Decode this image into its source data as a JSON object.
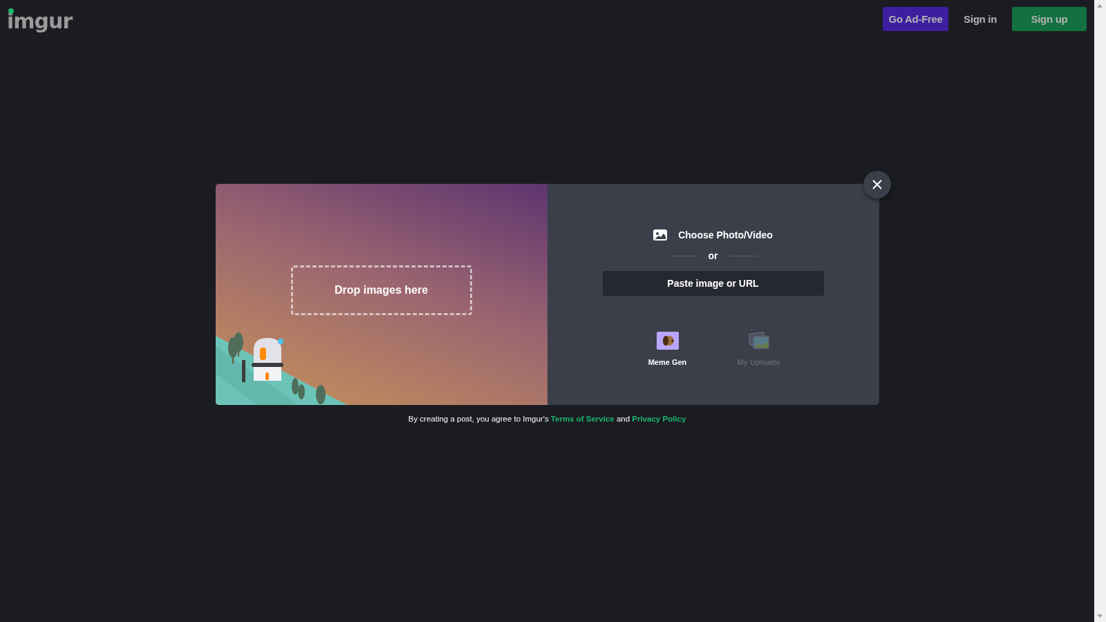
{
  "header": {
    "logo": "imgur",
    "buttons": [
      {
        "label": "Go Ad-Free",
        "kind": "premium"
      },
      {
        "label": "Sign in",
        "kind": "plain"
      },
      {
        "label": "Sign up",
        "kind": "primary"
      }
    ]
  },
  "upload_dialog": {
    "drop_zone": "Drop images here",
    "choose": "Choose Photo/Video",
    "divider": "or",
    "paste_button": "Paste image or URL",
    "options": [
      {
        "label": "Meme Gen",
        "kind": "meme",
        "disabled": false
      },
      {
        "label": "My Uploads",
        "kind": "uploads",
        "disabled": true
      }
    ]
  },
  "footer": [
    {
      "kind": "text",
      "text": "By creating a post, you agree to Imgur's"
    },
    {
      "kind": "link",
      "text": "Terms of Service"
    },
    {
      "kind": "text",
      "text": "and"
    },
    {
      "kind": "link",
      "text": "Privacy Policy"
    }
  ]
}
